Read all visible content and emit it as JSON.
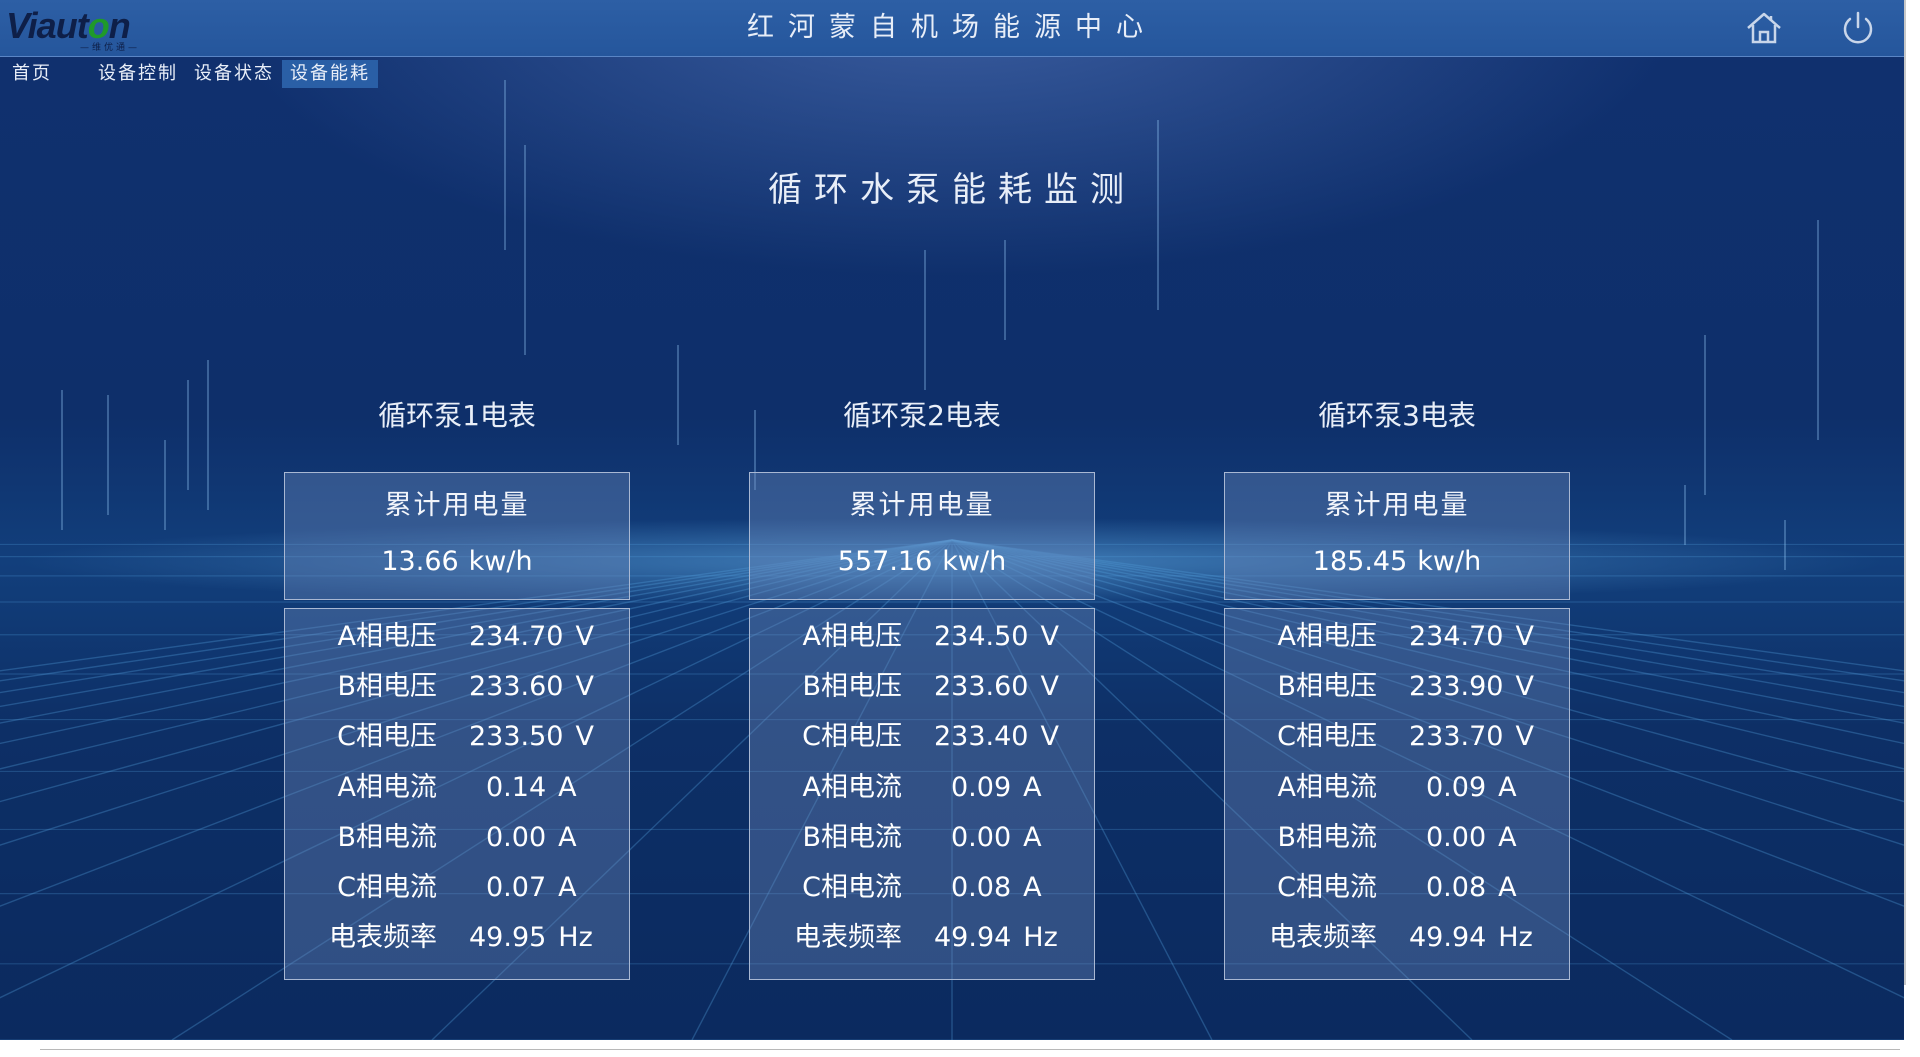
{
  "header": {
    "logo_text_a": "Viaut",
    "logo_text_o": "o",
    "logo_text_b": "n",
    "logo_sub": "—维优通—",
    "title": "红河蒙自机场能源中心",
    "home_icon": "home-icon",
    "power_icon": "power-icon"
  },
  "nav": {
    "items": [
      {
        "label": "首页"
      },
      {
        "label": "设备控制"
      },
      {
        "label": "设备状态"
      },
      {
        "label": "设备能耗"
      }
    ],
    "active": "设备能耗"
  },
  "page_title": "循环水泵能耗监测",
  "meters": [
    {
      "title": "循环泵1电表",
      "energy_label": "累计用电量",
      "energy_value": "13.66",
      "energy_unit": "kw/h",
      "readings": [
        {
          "label": "A相电压",
          "value": "234.70",
          "unit": "V"
        },
        {
          "label": "B相电压",
          "value": "233.60",
          "unit": "V"
        },
        {
          "label": "C相电压",
          "value": "233.50",
          "unit": "V"
        },
        {
          "label": "A相电流",
          "value": "0.14",
          "unit": "A"
        },
        {
          "label": "B相电流",
          "value": "0.00",
          "unit": "A"
        },
        {
          "label": "C相电流",
          "value": "0.07",
          "unit": "A"
        },
        {
          "label": "电表频率",
          "value": "49.95",
          "unit": "Hz"
        }
      ]
    },
    {
      "title": "循环泵2电表",
      "energy_label": "累计用电量",
      "energy_value": "557.16",
      "energy_unit": "kw/h",
      "readings": [
        {
          "label": "A相电压",
          "value": "234.50",
          "unit": "V"
        },
        {
          "label": "B相电压",
          "value": "233.60",
          "unit": "V"
        },
        {
          "label": "C相电压",
          "value": "233.40",
          "unit": "V"
        },
        {
          "label": "A相电流",
          "value": "0.09",
          "unit": "A"
        },
        {
          "label": "B相电流",
          "value": "0.00",
          "unit": "A"
        },
        {
          "label": "C相电流",
          "value": "0.08",
          "unit": "A"
        },
        {
          "label": "电表频率",
          "value": "49.94",
          "unit": "Hz"
        }
      ]
    },
    {
      "title": "循环泵3电表",
      "energy_label": "累计用电量",
      "energy_value": "185.45",
      "energy_unit": "kw/h",
      "readings": [
        {
          "label": "A相电压",
          "value": "234.70",
          "unit": "V"
        },
        {
          "label": "B相电压",
          "value": "233.90",
          "unit": "V"
        },
        {
          "label": "C相电压",
          "value": "233.70",
          "unit": "V"
        },
        {
          "label": "A相电流",
          "value": "0.09",
          "unit": "A"
        },
        {
          "label": "B相电流",
          "value": "0.00",
          "unit": "A"
        },
        {
          "label": "C相电流",
          "value": "0.08",
          "unit": "A"
        },
        {
          "label": "电表频率",
          "value": "49.94",
          "unit": "Hz"
        }
      ]
    }
  ],
  "colors": {
    "header_bg": "#2d5fa5",
    "nav_active_bg": "#2a5fa6",
    "panel_border": "#a9b8d3",
    "background": "#0e2f6a"
  }
}
